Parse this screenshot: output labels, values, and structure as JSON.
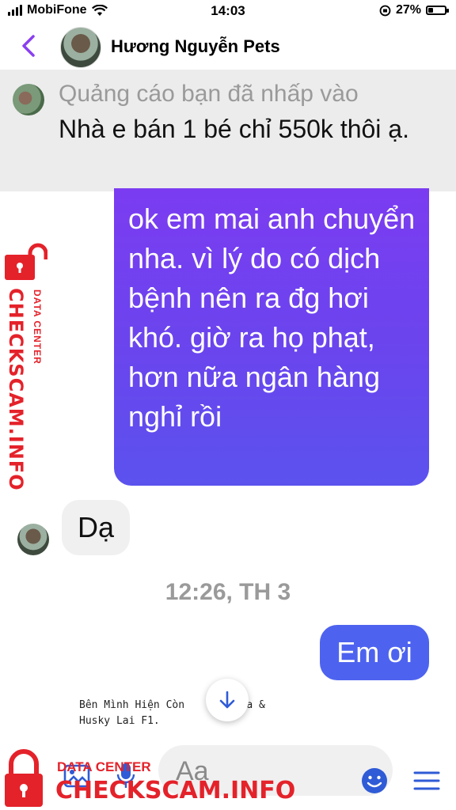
{
  "status_bar": {
    "carrier": "MobiFone",
    "time": "14:03",
    "battery": "27%",
    "battery_level": 0.27
  },
  "header": {
    "title": "Hương Nguyễn Pets"
  },
  "ad": {
    "note": "Quảng cáo bạn đã nhấp vào",
    "message": "Nhà e bán 1 bé chỉ 550k thôi ạ."
  },
  "messages": {
    "outgoing_1": "ok em mai anh chuyển nha. vì lý do có dịch bệnh nên ra đg hơi khó. giờ ra họ phạt, hơn nữa ngân hàng nghỉ rồi",
    "incoming_1": "Dạ",
    "timestamp": "12:26, TH 3",
    "outgoing_2": "Em ơi"
  },
  "preview": {
    "text": "Bên Mình Hiện Còn      laska &\nHusky Lai F1."
  },
  "composer": {
    "placeholder": "Aa"
  },
  "watermark": {
    "brand": "CHECKSCAM.INFO",
    "sub": "DATA CENTER",
    "color": "#e4222a"
  },
  "colors": {
    "accent": "#7b3cf1",
    "bubble_blue": "#4d63ef",
    "icon_blue": "#2f5bd6"
  },
  "icons": [
    "back-icon",
    "wifi-icon",
    "lock-icon",
    "gallery-icon",
    "mic-icon",
    "emoji-icon",
    "menu-icon",
    "arrow-down-icon"
  ]
}
